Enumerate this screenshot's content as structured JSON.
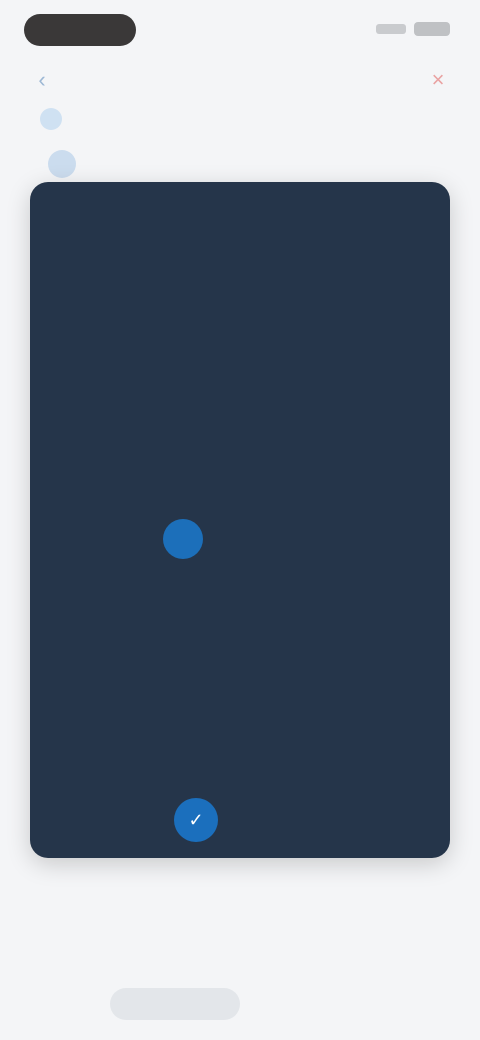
{
  "status_bar": {
    "time": "",
    "signal_icon": "signal-icon",
    "battery_icon": "battery-icon"
  },
  "header": {
    "title": "",
    "subtitle": "",
    "back_icon": "chevron-left-icon",
    "close_icon": "close-icon"
  },
  "sub_row": {
    "icon": "calendar-icon",
    "text": ""
  },
  "calendar": {
    "top_left": "",
    "top_title": "",
    "top_right": "",
    "selected_date": "",
    "month": "",
    "year": "",
    "weekdays": [
      "",
      "",
      "",
      "",
      "",
      "",
      ""
    ],
    "days": [
      "",
      "",
      "",
      "",
      "",
      "",
      "",
      "",
      "",
      "",
      "",
      "",
      "",
      "",
      "",
      "",
      "",
      "",
      "",
      "",
      "",
      "",
      "",
      "",
      ""
    ],
    "selected_index": 2,
    "footer_left": "",
    "footer_right": "",
    "confirm_icon": "check-icon",
    "accent_color": "#1c6fba",
    "background_color": "#25354a"
  },
  "below": {
    "line_1": "",
    "line_2": "",
    "button_label": ""
  }
}
